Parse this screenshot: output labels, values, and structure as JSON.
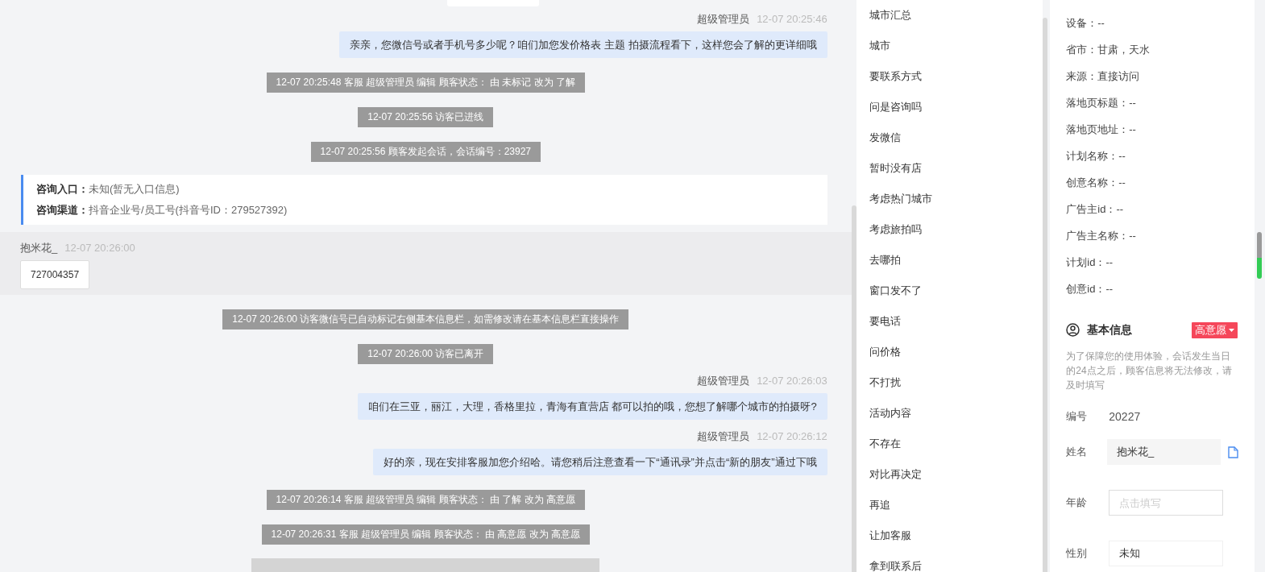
{
  "chat": {
    "messages": [
      {
        "kind": "agent",
        "sender": "超级管理员",
        "time": "12-07 20:25:46",
        "text": "亲亲，您微信号或者手机号多少呢？咱们加您发价格表 主题 拍摄流程看下，这样您会了解的更详细哦"
      },
      {
        "kind": "system",
        "text": "12-07 20:25:48 客服 超级管理员 编辑 顾客状态： 由 未标记 改为 了解"
      },
      {
        "kind": "system",
        "text": "12-07 20:25:56 访客已进线"
      },
      {
        "kind": "system",
        "text": "12-07 20:25:56 顾客发起会话，会话编号：23927"
      },
      {
        "kind": "entry",
        "lines": [
          {
            "label": "咨询入口：",
            "value": "未知(暂无入口信息)"
          },
          {
            "label": "咨询渠道：",
            "value": "抖音企业号/员工号(抖音号ID：279527392)"
          }
        ]
      },
      {
        "kind": "visitor",
        "sender": "抱米花_",
        "time": "12-07 20:26:00",
        "text": "727004357"
      },
      {
        "kind": "system",
        "text": "12-07 20:26:00 访客微信号已自动标记右侧基本信息栏，如需修改请在基本信息栏直接操作"
      },
      {
        "kind": "system",
        "text": "12-07 20:26:00 访客已离开"
      },
      {
        "kind": "agent",
        "sender": "超级管理员",
        "time": "12-07 20:26:03",
        "text": "咱们在三亚，丽江，大理，香格里拉，青海有直营店 都可以拍的哦，您想了解哪个城市的拍摄呀?"
      },
      {
        "kind": "agent",
        "sender": "超级管理员",
        "time": "12-07 20:26:12",
        "text": "好的亲，现在安排客服加您介绍哈。请您稍后注意查看一下“通讯录”并点击“新的朋友”通过下哦"
      },
      {
        "kind": "system",
        "text": "12-07 20:26:14 客服 超级管理员 编辑 顾客状态： 由 了解 改为 高意愿"
      },
      {
        "kind": "system",
        "text": "12-07 20:26:31 客服 超级管理员 编辑 顾客状态： 由 高意愿 改为 高意愿"
      }
    ]
  },
  "quick_replies": [
    "城市汇总",
    "城市",
    "要联系方式",
    "问是咨询吗",
    "发微信",
    "暂时没有店",
    "考虑热门城市",
    "考虑旅拍吗",
    "去哪拍",
    "窗口发不了",
    "要电话",
    "问价格",
    "不打扰",
    "活动内容",
    "不存在",
    "对比再决定",
    "再追",
    "让加客服",
    "拿到联系后"
  ],
  "visitor_info": [
    "设备：--",
    "省市：甘肃，天水",
    "来源：直接访问",
    "落地页标题：--",
    "落地页地址：--",
    "计划名称：--",
    "创意名称：--",
    "广告主id：--",
    "广告主名称：--",
    "计划id：--",
    "创意id：--"
  ],
  "basic_info": {
    "title": "基本信息",
    "status": "高意愿",
    "note": "为了保障您的使用体验，会话发生当日的24点之后，顾客信息将无法修改，请及时填写",
    "fields": [
      {
        "kind": "text",
        "label": "编号",
        "value": "20227"
      },
      {
        "kind": "filled",
        "label": "姓名",
        "value": "抱米花_"
      },
      {
        "kind": "input",
        "label": "年龄",
        "placeholder": "点击填写"
      },
      {
        "kind": "select",
        "label": "性别",
        "value": "未知"
      }
    ]
  }
}
